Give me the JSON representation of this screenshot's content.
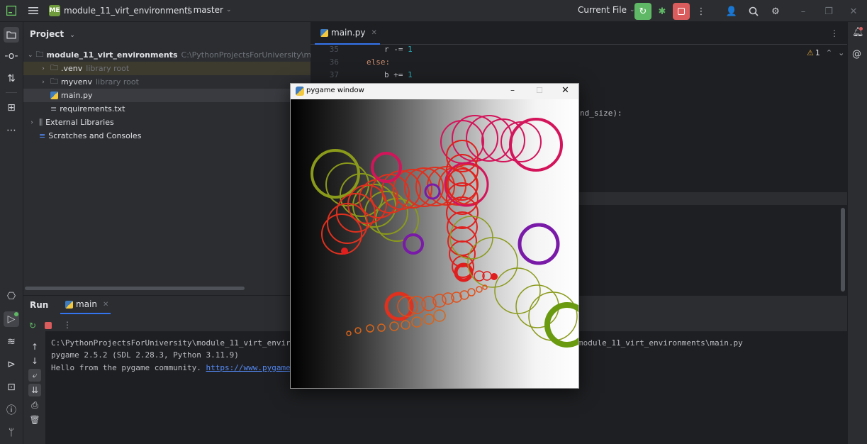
{
  "titlebar": {
    "project_badge": "ME",
    "project_name": "module_11_virt_environments",
    "branch": "master",
    "run_config": "Current File",
    "colors": {
      "run_green": "#5fb865",
      "stop_red": "#db5c5c"
    }
  },
  "project_panel": {
    "title": "Project",
    "tree": [
      {
        "label": "module_11_virt_environments",
        "path": "C:\\PythonProjectsForUniversity\\module_"
      },
      {
        "label": ".venv",
        "hint": "library root"
      },
      {
        "label": "myvenv",
        "hint": "library root"
      },
      {
        "label": "main.py"
      },
      {
        "label": "requirements.txt"
      },
      {
        "label": "External Libraries"
      },
      {
        "label": "Scratches and Consoles"
      }
    ]
  },
  "editor": {
    "tab": "main.py",
    "line_numbers": [
      "35",
      "36",
      "37"
    ],
    "code": {
      "line35_var": "r",
      "line35_op": "-=",
      "line35_num": "1",
      "line36_kw": "else:",
      "line37_var": "b",
      "line37_op": "+=",
      "line37_num": "1",
      "partial": "nd_size):"
    },
    "warning_count": "1"
  },
  "run_panel": {
    "title": "Run",
    "tab": "main",
    "console": {
      "line1a": "C:\\PythonProjectsForUniversity\\module_11_virt_environ",
      "line1b": "module_11_virt_environments\\main.py",
      "line2": "pygame 2.5.2 (SDL 2.28.3, Python 3.11.9)",
      "line3_text": "Hello from the pygame community. ",
      "line3_link": "https://www.pygame.o"
    }
  },
  "pygame_window": {
    "title": "pygame window",
    "circle_colors": {
      "olive": "#8a9a1a",
      "red": "#e01e1e",
      "crimson": "#d4145a",
      "purple": "#7a1aa8",
      "orange": "#e0501a",
      "green": "#6a9a10"
    }
  }
}
